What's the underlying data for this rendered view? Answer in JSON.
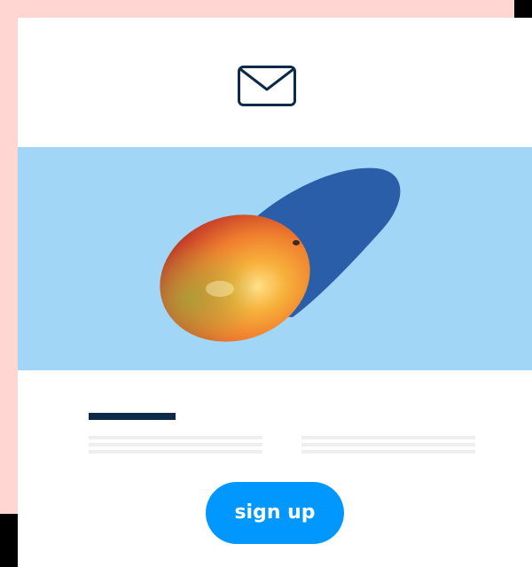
{
  "colors": {
    "page_background": "#000000",
    "accent_pink": "#ffd6d2",
    "card": "#ffffff",
    "hero_background": "#a1d6f6",
    "heading_bar": "#0e2a4a",
    "text_placeholder": "#eeeeee",
    "button": "#0098ff",
    "button_text": "#ffffff"
  },
  "header": {
    "icon": "envelope-icon"
  },
  "hero": {
    "image": "mango-with-shadow"
  },
  "content": {
    "heading_placeholder": "dark-bar",
    "columns": [
      {
        "placeholder_lines": 3
      },
      {
        "placeholder_lines": 3
      }
    ]
  },
  "cta": {
    "label": "sign up"
  }
}
